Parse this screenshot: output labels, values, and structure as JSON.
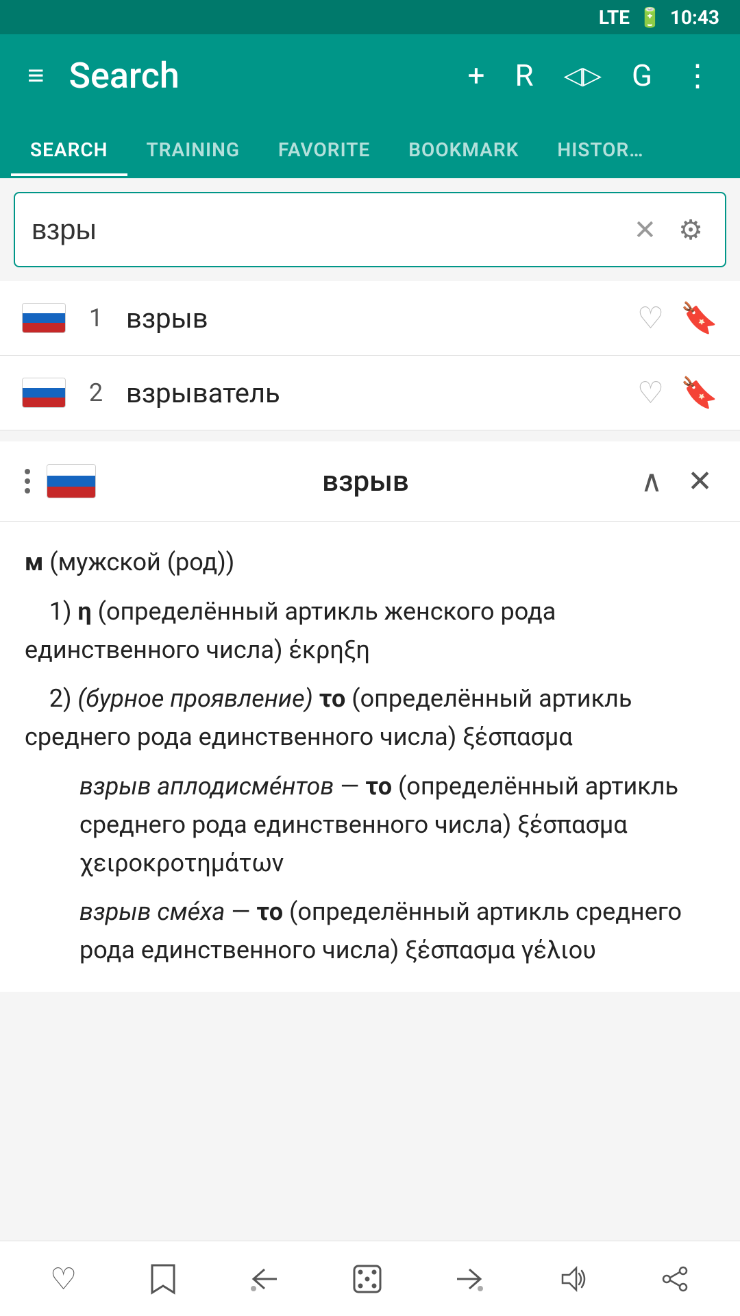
{
  "statusBar": {
    "time": "10:43",
    "signal": "LTE"
  },
  "appBar": {
    "title": "Search",
    "menuIcon": "≡",
    "addIcon": "+",
    "rLabel": "R",
    "gLabel": "G",
    "moreIcon": "⋮"
  },
  "tabs": [
    {
      "id": "search",
      "label": "SEARCH",
      "active": true
    },
    {
      "id": "training",
      "label": "TRAINING",
      "active": false
    },
    {
      "id": "favorite",
      "label": "FAVORITE",
      "active": false
    },
    {
      "id": "bookmark",
      "label": "BOOKMARK",
      "active": false
    },
    {
      "id": "history",
      "label": "HISTOR…",
      "active": false
    }
  ],
  "searchBar": {
    "value": "взры",
    "clearLabel": "✕",
    "settingsLabel": "⚙"
  },
  "results": [
    {
      "number": "1",
      "word": "взрыв"
    },
    {
      "number": "2",
      "word": "взрыватель"
    }
  ],
  "detailPanel": {
    "word": "взрыв",
    "chevronUp": "∧",
    "closeLabel": "✕",
    "definition": "м (мужской (род))\n    1) η (определённый артикль женского рода единственного числа) έκρηξη\n    2) (бурное проявление) το (определённый артикль среднего рода единственного числа) ξέσπασμα\n        взрыв аплодисме́нтов — το (определённый артикль среднего рода единственного числа) ξέσπασμα χειροκροτημάτων\n        взрыв сме́ха — το (определённый артикль среднего рода единственного числа) ξέσπασμα γέλιου"
  },
  "bottomBar": {
    "heartIcon": "♡",
    "bookmarkIcon": "⌖",
    "backIcon": "←",
    "diceIcon": "⚄",
    "forwardIcon": "→",
    "volumeIcon": "🔊",
    "shareIcon": "↗"
  }
}
